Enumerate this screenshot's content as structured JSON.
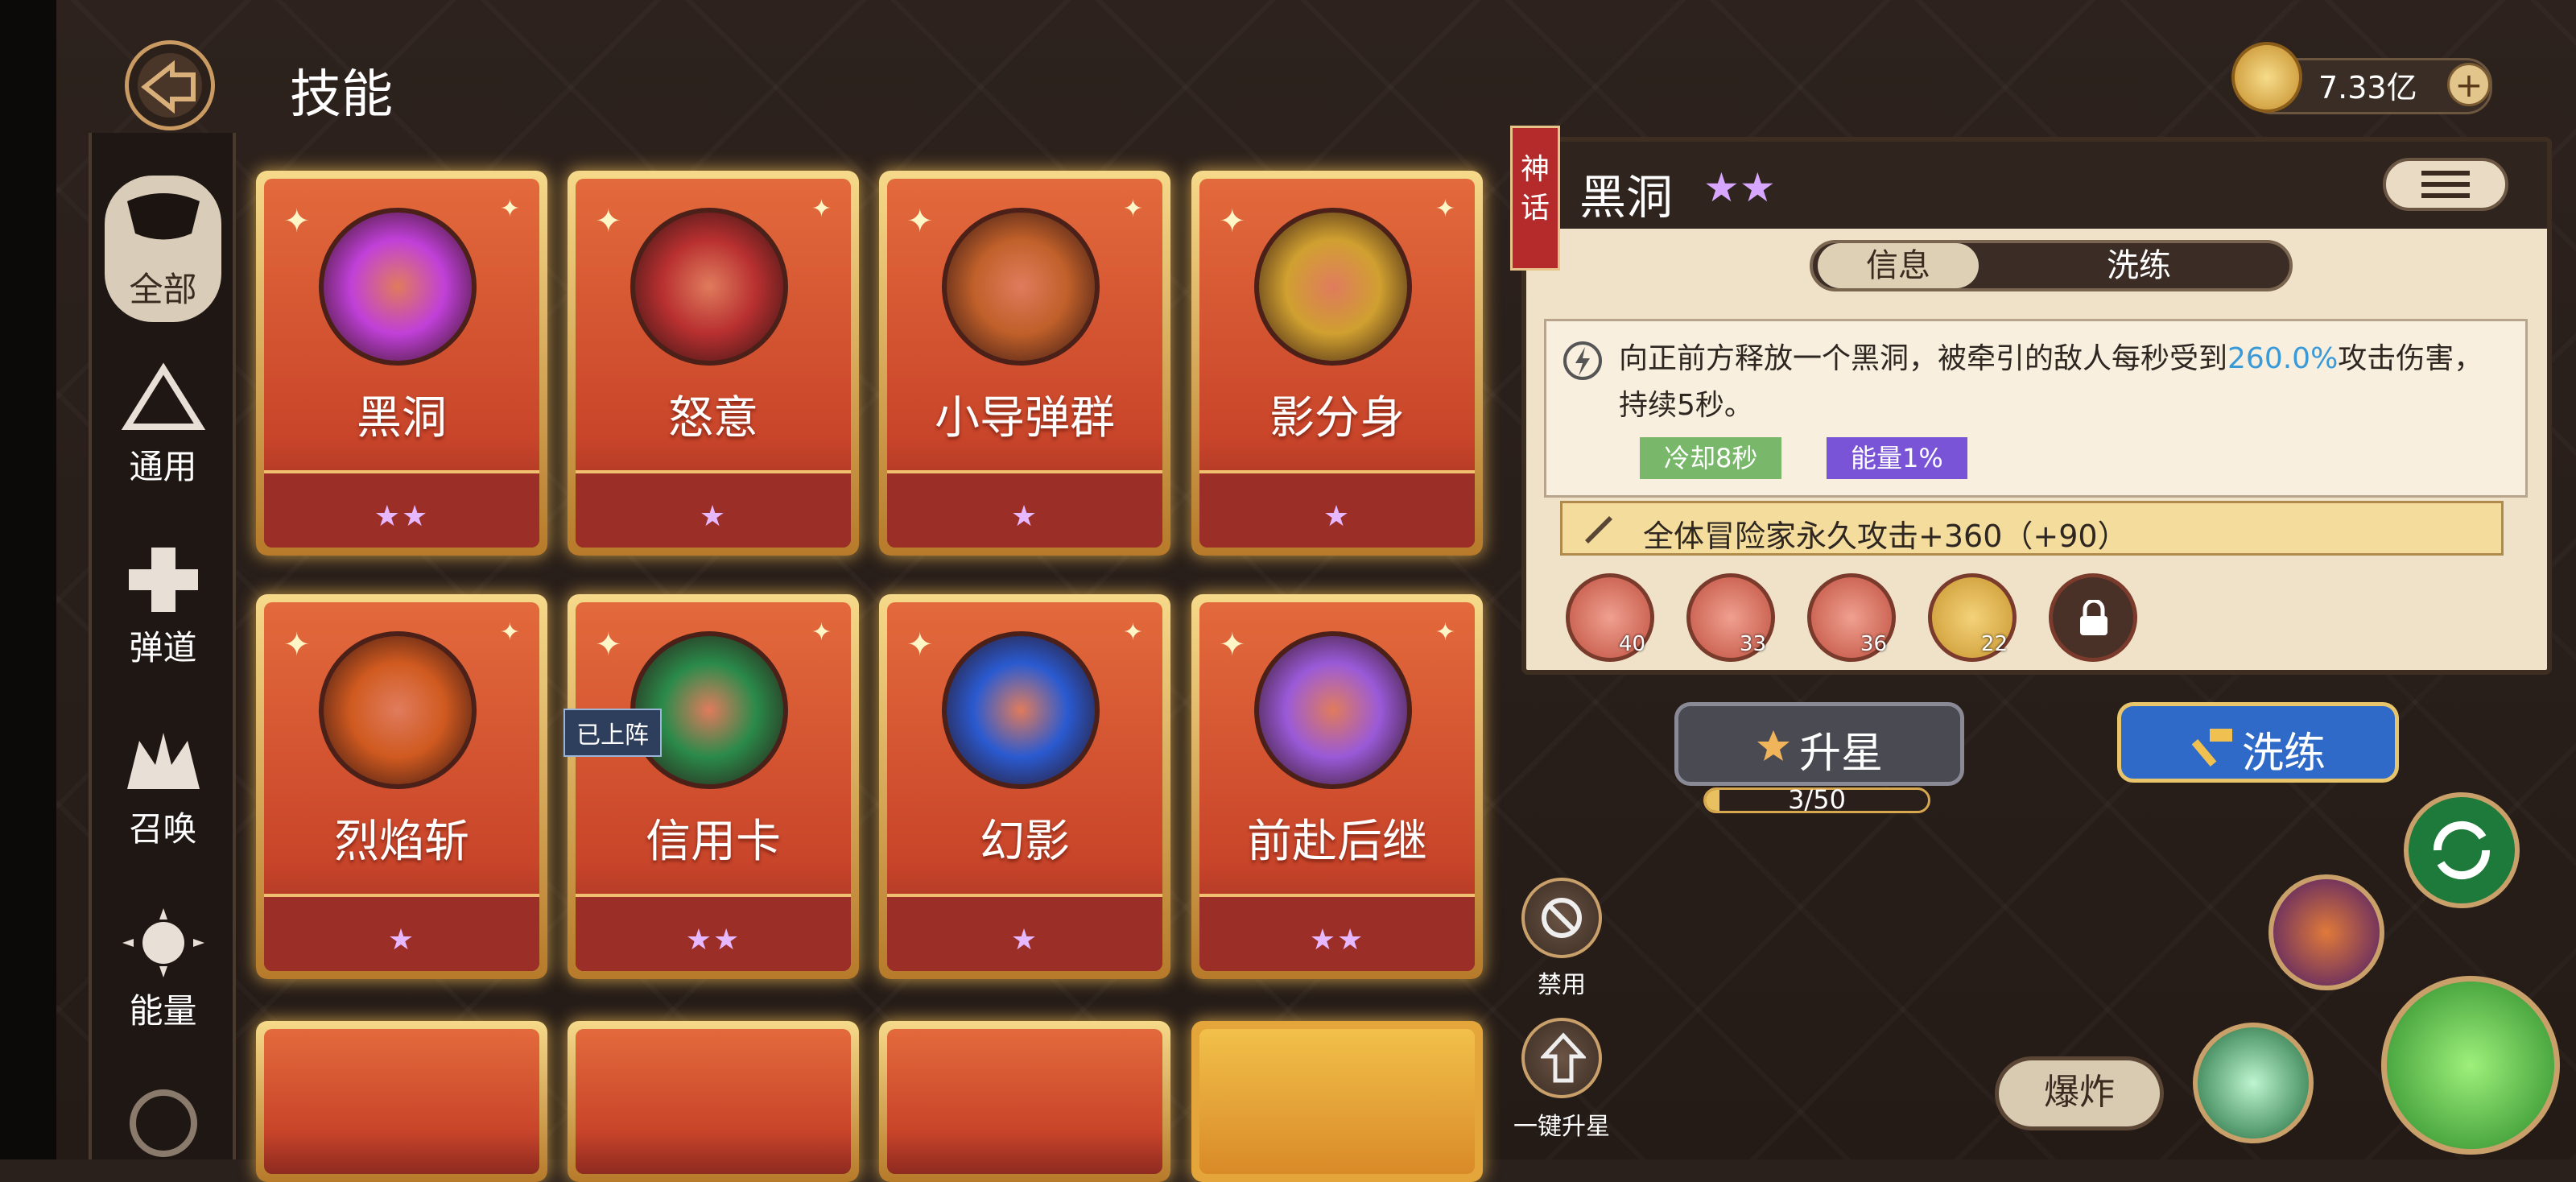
{
  "header": {
    "title": "技能"
  },
  "currency": {
    "value": "7.33亿",
    "plus": "+"
  },
  "sidebar": {
    "items": [
      {
        "label": "全部",
        "icon": "all-icon",
        "active": true
      },
      {
        "label": "通用",
        "icon": "general-icon"
      },
      {
        "label": "弹道",
        "icon": "ballistic-icon"
      },
      {
        "label": "召唤",
        "icon": "summon-icon"
      },
      {
        "label": "能量",
        "icon": "energy-icon"
      }
    ]
  },
  "cards": [
    {
      "name": "黑洞",
      "stars": "★★",
      "color": "#c040d8"
    },
    {
      "name": "怒意",
      "stars": "★",
      "color": "#b83030"
    },
    {
      "name": "小导弹群",
      "stars": "★",
      "color": "#c0602a"
    },
    {
      "name": "影分身",
      "stars": "★",
      "color": "#d0a030"
    },
    {
      "name": "烈焰斩",
      "stars": "★",
      "color": "#d05a20"
    },
    {
      "name": "信用卡",
      "stars": "★★",
      "color": "#2a8a4a"
    },
    {
      "name": "幻影",
      "stars": "★",
      "color": "#2a5ad0"
    },
    {
      "name": "前赴后继",
      "stars": "★★",
      "color": "#9a5ad8"
    }
  ],
  "on_team_badge": "已上阵",
  "detail": {
    "rarity": "神话",
    "title": "黑洞",
    "stars": "★★",
    "tabs": [
      "信息",
      "洗练"
    ],
    "desc_pre": "向正前方释放一个黑洞，被牵引的敌人每秒受到",
    "desc_hl": "260.0%",
    "desc_post": "攻击伤害，持续5秒。",
    "cooldown": "冷却8秒",
    "energy": "能量1%",
    "bonus": "全体冒险家永久攻击+360（+90）",
    "runes": [
      "40",
      "33",
      "36",
      "22"
    ]
  },
  "actions": {
    "star_up": "升星",
    "progress_text": "3/50",
    "progress": 0.06,
    "reroll": "洗练",
    "disable": "禁用",
    "one_key_star": "一键升星",
    "explode": "爆炸"
  }
}
